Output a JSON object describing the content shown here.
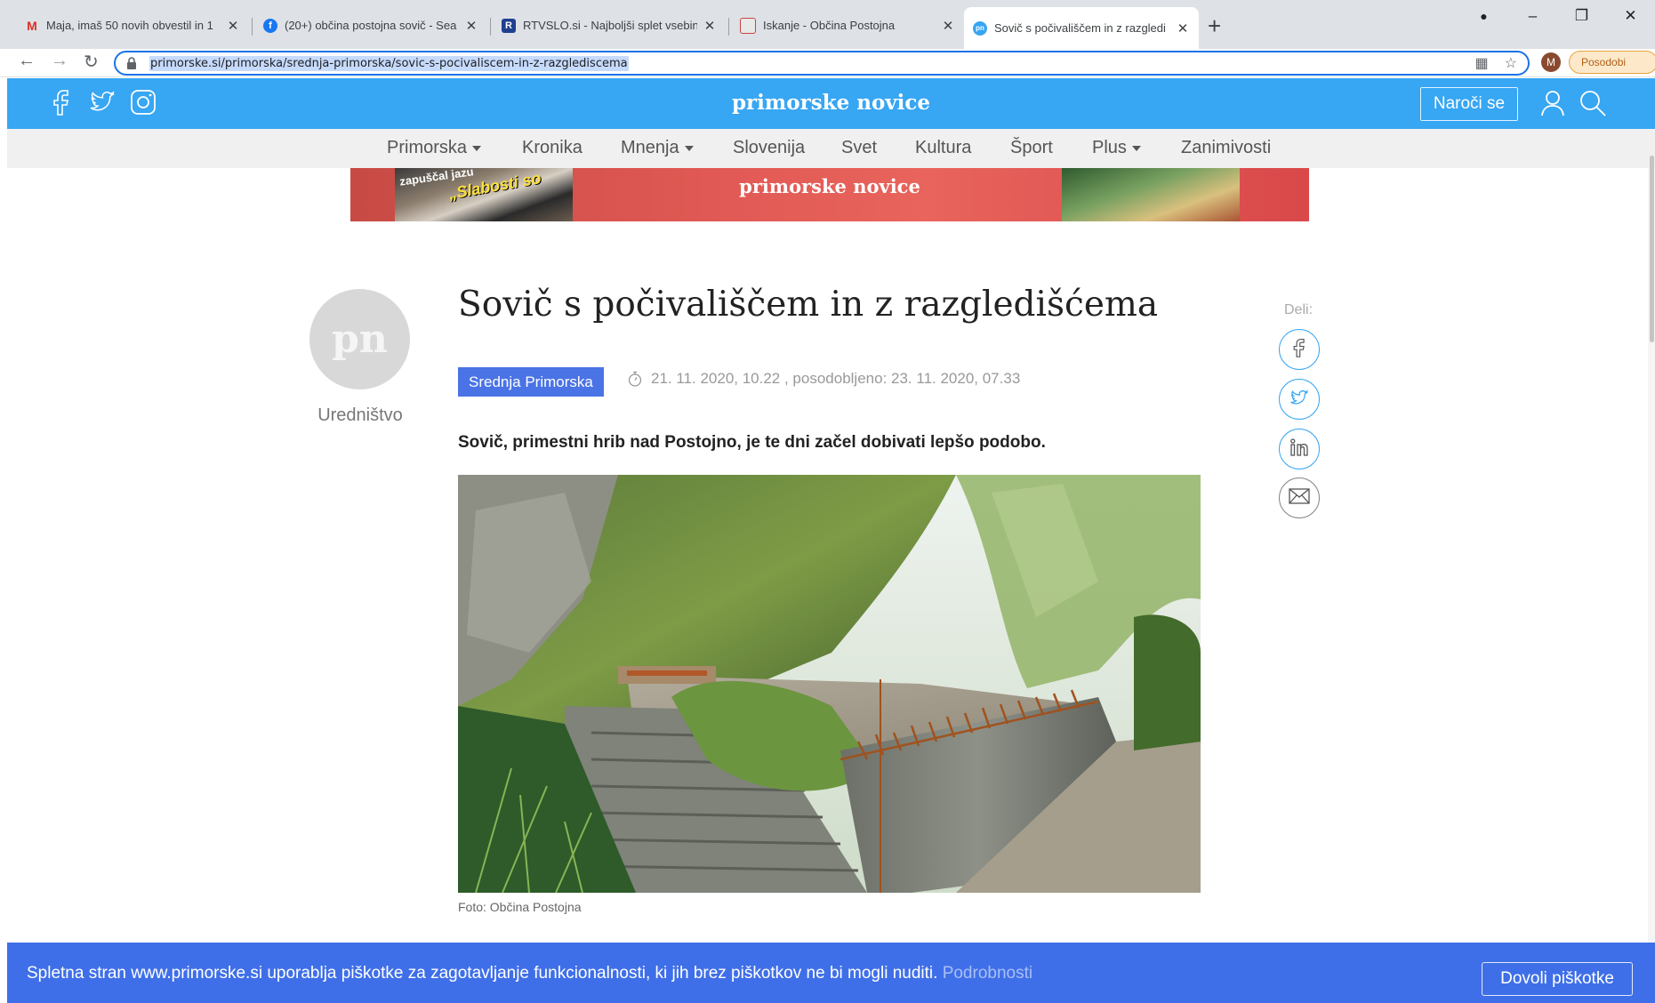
{
  "browser": {
    "tabs": [
      {
        "title": "Maja, imaš 50 novih obvestil in 1",
        "favicon": "gmail-icon"
      },
      {
        "title": "(20+) občina postojna sovič - Sea",
        "favicon": "facebook-icon"
      },
      {
        "title": "RTVSLO.si - Najboljši splet vsebin",
        "favicon": "rtvslo-icon"
      },
      {
        "title": "Iskanje - Občina Postojna",
        "favicon": "postojna-icon"
      },
      {
        "title": "Sovič s počivališčem in z razgledi",
        "favicon": "pn-icon"
      }
    ],
    "favicon_labels": {
      "gmail": "M",
      "rtv": "R",
      "pn": "pn"
    },
    "url": "primorske.si/primorska/srednja-primorska/sovic-s-pocivaliscem-in-z-razglediscema",
    "profile_initial": "M",
    "update_label": "Posodobi"
  },
  "site": {
    "brand": "primorske novice",
    "subscribe_label": "Naroči se",
    "nav": [
      {
        "label": "Primorska",
        "dropdown": true
      },
      {
        "label": "Kronika",
        "dropdown": false
      },
      {
        "label": "Mnenja",
        "dropdown": true
      },
      {
        "label": "Slovenija",
        "dropdown": false
      },
      {
        "label": "Svet",
        "dropdown": false
      },
      {
        "label": "Kultura",
        "dropdown": false
      },
      {
        "label": "Šport",
        "dropdown": false
      },
      {
        "label": "Plus",
        "dropdown": true
      },
      {
        "label": "Zanimivosti",
        "dropdown": false
      }
    ],
    "banner": {
      "title": "primorske novice",
      "left_text": "zapuščal jazu",
      "right_text": "„Slabosti so"
    },
    "colors": {
      "header": "#37a6f3",
      "badge": "#4a73e6",
      "cookie": "#3f6fe8"
    }
  },
  "article": {
    "author_initials": "pn",
    "author": "Uredništvo",
    "title": "Sovič s počivališčem in z razgledišćema",
    "category": "Srednja Primorska",
    "meta": "21. 11. 2020, 10.22 , posodobljeno: 23. 11. 2020, 07.33",
    "lead": "Sovič, primestni hrib nad Postojno, je te dni začel dobivati lepšo podobo.",
    "photo_caption": "Foto: Občina Postojna"
  },
  "share": {
    "label": "Deli:",
    "buttons": [
      "facebook-icon",
      "twitter-icon",
      "linkedin-icon",
      "email-icon"
    ]
  },
  "cookie": {
    "text": "Spletna stran www.primorske.si uporablja piškotke za zagotavljanje funkcionalnosti, ki jih brez piškotkov ne bi mogli nuditi.",
    "more_label": "Podrobnosti",
    "accept_label": "Dovoli piškotke"
  }
}
